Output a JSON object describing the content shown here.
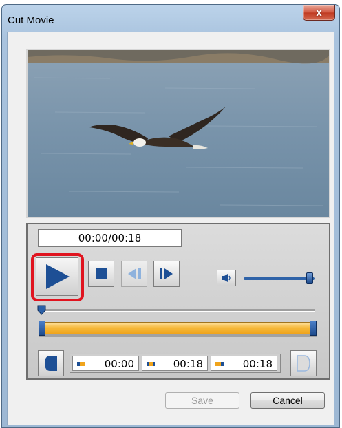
{
  "window": {
    "title": "Cut Movie",
    "close_glyph": "x"
  },
  "player": {
    "time_display": "00:00/00:18",
    "volume_level": 0.97,
    "seek_position": 0.0
  },
  "controls": {
    "play": "play-icon",
    "stop": "stop-icon",
    "prev_frame": "previous-frame-icon",
    "next_frame": "next-frame-icon",
    "volume": "speaker-icon"
  },
  "cut": {
    "range_start": 0.0,
    "range_end": 1.0,
    "start_time": "00:00",
    "end_time": "00:18",
    "duration": "00:18"
  },
  "buttons": {
    "save": "Save",
    "cancel": "Cancel"
  },
  "colors": {
    "accent_blue": "#1d4a8b",
    "range_orange": "#f0a41c",
    "highlight_red": "#e0141f"
  }
}
